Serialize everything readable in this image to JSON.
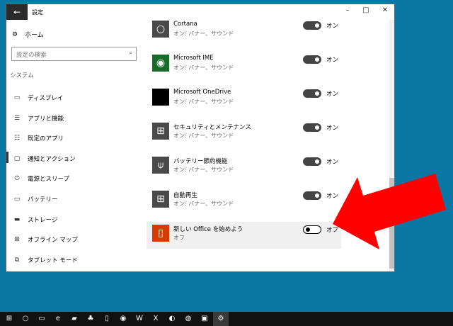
{
  "window": {
    "title": "設定",
    "back_icon": "←",
    "minimize": "–",
    "maximize": "□",
    "close": "✕"
  },
  "sidebar": {
    "home": "ホーム",
    "search_placeholder": "設定の検索",
    "category": "システム",
    "items": [
      {
        "label": "ディスプレイ",
        "icon": "▭"
      },
      {
        "label": "アプリと機能",
        "icon": "☰"
      },
      {
        "label": "既定のアプリ",
        "icon": "☷"
      },
      {
        "label": "通知とアクション",
        "icon": "▢",
        "selected": true
      },
      {
        "label": "電源とスリープ",
        "icon": "⏻"
      },
      {
        "label": "バッテリー",
        "icon": "▭"
      },
      {
        "label": "ストレージ",
        "icon": "▬"
      },
      {
        "label": "オフライン マップ",
        "icon": "⊞"
      },
      {
        "label": "タブレット モード",
        "icon": "⧉"
      }
    ]
  },
  "apps": [
    {
      "name": "Cortana",
      "status": "オン: バナー、サウンド",
      "toggle": "オン",
      "on": true,
      "icon": "○",
      "color": "#4a4a4a"
    },
    {
      "name": "Microsoft IME",
      "status": "オン: バナー、サウンド",
      "toggle": "オン",
      "on": true,
      "icon": "◉",
      "color": "#1a6b2a"
    },
    {
      "name": "Microsoft OneDrive",
      "status": "オン: バナー、サウンド",
      "toggle": "オン",
      "on": true,
      "icon": "",
      "color": "#000000"
    },
    {
      "name": "セキュリティとメンテナンス",
      "status": "オン: バナー、サウンド",
      "toggle": "オン",
      "on": true,
      "icon": "⊞",
      "color": "#4a4a4a"
    },
    {
      "name": "バッテリー節約機能",
      "status": "オン: バナー、サウンド",
      "toggle": "オン",
      "on": true,
      "icon": "⍦",
      "color": "#4a4a4a"
    },
    {
      "name": "自動再生",
      "status": "オン: バナー、サウンド",
      "toggle": "オン",
      "on": true,
      "icon": "⊞",
      "color": "#4a4a4a"
    },
    {
      "name": "新しい Office を始めよう",
      "status": "オフ",
      "toggle": "オフ",
      "on": false,
      "icon": "▯",
      "color": "#d83b01"
    }
  ],
  "annotation": {
    "arrow_color": "#ff0000"
  },
  "taskbar": [
    "⊞",
    "○",
    "▭",
    "e",
    "▰",
    "♣",
    "▯",
    "◉",
    "W",
    "X",
    "◐",
    "◍",
    "▣",
    "⚙"
  ]
}
